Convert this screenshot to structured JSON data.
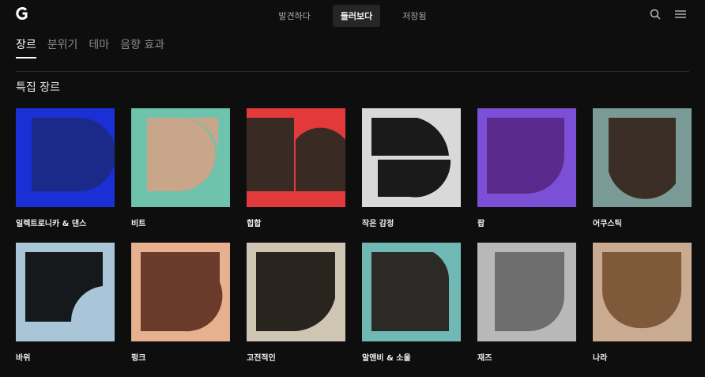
{
  "nav": {
    "tabs": [
      {
        "label": "발견하다",
        "active": false
      },
      {
        "label": "둘러보다",
        "active": true
      },
      {
        "label": "저장됨",
        "active": false
      }
    ]
  },
  "subtabs": [
    {
      "label": "장르",
      "active": true
    },
    {
      "label": "분위기",
      "active": false
    },
    {
      "label": "테마",
      "active": false
    },
    {
      "label": "음향 효과",
      "active": false
    }
  ],
  "section": {
    "title": "특집 장르"
  },
  "cards": [
    {
      "label": "일렉트로니카 & 댄스",
      "bg": "#1a2fd6",
      "photo": "#1b2a8a"
    },
    {
      "label": "비트",
      "bg": "#6fc2ab",
      "photo": "#c9a58a"
    },
    {
      "label": "힙합",
      "bg": "#e23a3a",
      "photo": "#3a2a24"
    },
    {
      "label": "작은 감정",
      "bg": "#d9d9d9",
      "photo": "#1a1a1a"
    },
    {
      "label": "팝",
      "bg": "#7b4fd6",
      "photo": "#5a2a8c"
    },
    {
      "label": "어쿠스틱",
      "bg": "#7a9a96",
      "photo": "#3a2e26"
    },
    {
      "label": "바위",
      "bg": "#a9c6d8",
      "photo": "#15191c"
    },
    {
      "label": "펑크",
      "bg": "#e7b08e",
      "photo": "#6a3a2a"
    },
    {
      "label": "고전적인",
      "bg": "#cfc5b3",
      "photo": "#2a241e"
    },
    {
      "label": "알앤비 & 소울",
      "bg": "#6fb8b4",
      "photo": "#2c2a26"
    },
    {
      "label": "재즈",
      "bg": "#b8b8b8",
      "photo": "#6e6e6e"
    },
    {
      "label": "나라",
      "bg": "#c9ab92",
      "photo": "#7e5a3a"
    }
  ]
}
